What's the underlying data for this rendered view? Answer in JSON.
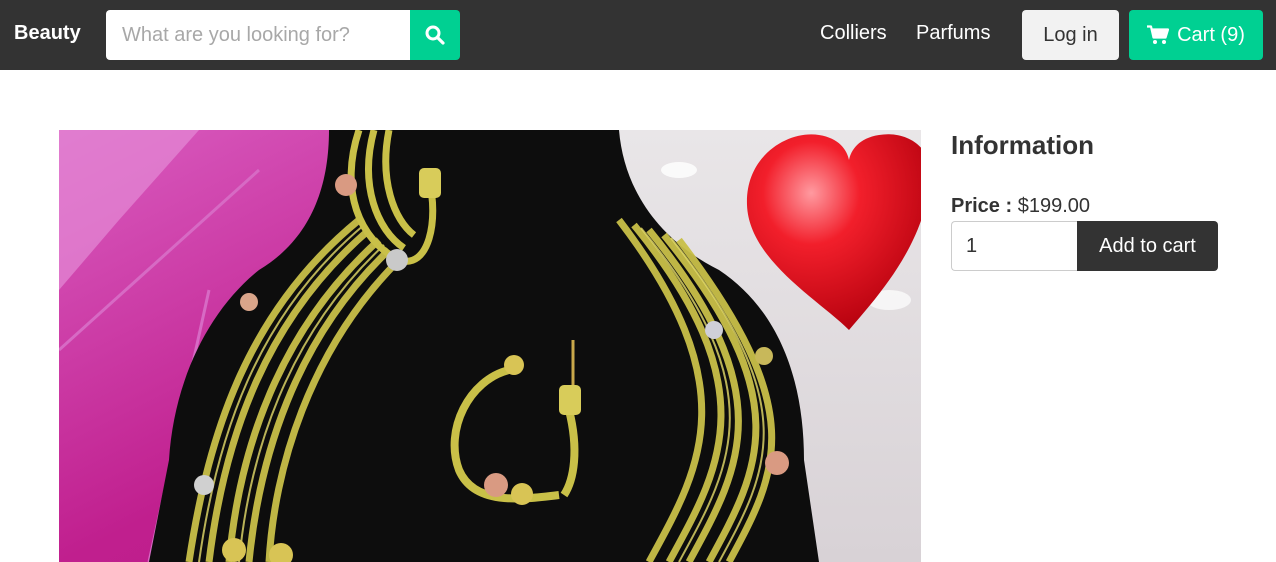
{
  "header": {
    "brand": "Beauty",
    "search_placeholder": "What are you looking for?",
    "search_value": "",
    "nav_links": [
      "Colliers",
      "Parfums"
    ],
    "login_label": "Log in",
    "cart_label": "Cart (9)",
    "icons": {
      "search": "search-icon",
      "cart": "shopping-cart-icon"
    },
    "colors": {
      "navbar": "#333333",
      "accent": "#00d092"
    }
  },
  "product": {
    "image_alt": "gold-mesh-jewelry-set",
    "info_title": "Information",
    "price_label": "Price :",
    "price_value": "$199.00",
    "quantity": "1",
    "add_to_cart_label": "Add to cart"
  }
}
